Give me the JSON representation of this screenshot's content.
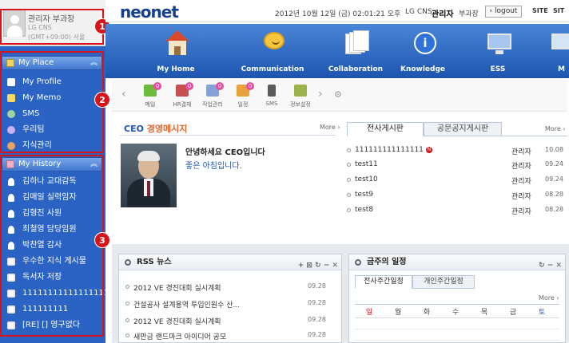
{
  "profile": {
    "name": "관리자 부과장",
    "company": "LG CNS",
    "timezone": "(GMT+09:00) 서울"
  },
  "sidebar": {
    "my_place": {
      "title": "My Place",
      "items": [
        {
          "label": "My Profile",
          "icon": "profile-icon"
        },
        {
          "label": "My Memo",
          "icon": "memo-icon"
        },
        {
          "label": "SMS",
          "icon": "sms-icon"
        },
        {
          "label": "우리팀",
          "icon": "team-icon"
        },
        {
          "label": "지식관리",
          "icon": "knowledge-icon"
        }
      ]
    },
    "my_history": {
      "title": "My History",
      "items": [
        {
          "label": "김하나 교대감독",
          "icon": "person-icon"
        },
        {
          "label": "김매일 실력임자",
          "icon": "person-icon"
        },
        {
          "label": "김형진 사원",
          "icon": "person-icon"
        },
        {
          "label": "최철영 담당임원",
          "icon": "person-icon"
        },
        {
          "label": "박찬열 감사",
          "icon": "person-icon"
        },
        {
          "label": "우수한 지식 게시물",
          "icon": "page-icon"
        },
        {
          "label": "독서자 저장",
          "icon": "page-icon"
        },
        {
          "label": "11111111111111111",
          "icon": "page-icon"
        },
        {
          "label": "111111111",
          "icon": "page-icon"
        },
        {
          "label": "[RE] [] 영구없다",
          "icon": "page-icon"
        }
      ]
    }
  },
  "callouts": [
    "1",
    "2",
    "3"
  ],
  "header": {
    "logo": "neonet",
    "datetime": "2012년 10월 12일 (금) 02:01:21 오후",
    "company": "LG CNS",
    "admin": "관리자",
    "title": "부과장",
    "logout": "logout",
    "site_links": [
      "SITE",
      "SIT"
    ]
  },
  "mainnav": [
    {
      "label": "My Home",
      "icon": "home-icon"
    },
    {
      "label": "Communication",
      "icon": "chat-bubble-icon"
    },
    {
      "label": "Collaboration",
      "icon": "documents-icon"
    },
    {
      "label": "Knowledge",
      "icon": "info-icon"
    },
    {
      "label": "ESS",
      "icon": "computer-icon"
    },
    {
      "label": "M",
      "icon": "more-menu-icon"
    }
  ],
  "quickbar": [
    {
      "label": "메일",
      "badge": "0",
      "icon": "mail-icon",
      "color": "#6dbb3a"
    },
    {
      "label": "HR결재",
      "badge": "0",
      "icon": "approval-icon",
      "color": "#c74f4f"
    },
    {
      "label": "작업관리",
      "badge": "0",
      "icon": "task-icon",
      "color": "#84a2d8"
    },
    {
      "label": "일정",
      "badge": "0",
      "icon": "calendar-icon",
      "color": "#e8a23c"
    },
    {
      "label": "SMS",
      "badge": "",
      "icon": "phone-icon",
      "color": "#5a5a5a"
    },
    {
      "label": "정보설정",
      "badge": "",
      "icon": "settings-icon",
      "color": "#9bb44a"
    }
  ],
  "ceo": {
    "title_prefix": "CEO ",
    "title_main": "경영메시지",
    "more": "More",
    "greeting": "안녕하세요 CEO입니다",
    "message": "좋은 아침입니다."
  },
  "board": {
    "tabs": [
      "전사게시판",
      "공문공지게시판"
    ],
    "more": "More",
    "rows": [
      {
        "title": "111111111111111",
        "new": "N",
        "author": "관리자",
        "date": "10.08"
      },
      {
        "title": "test11",
        "new": "",
        "author": "관리자",
        "date": "09.24"
      },
      {
        "title": "test10",
        "new": "",
        "author": "관리자",
        "date": "09.24"
      },
      {
        "title": "test9",
        "new": "",
        "author": "관리자",
        "date": "08.28"
      },
      {
        "title": "test8",
        "new": "",
        "author": "관리자",
        "date": "08.28"
      }
    ]
  },
  "rss": {
    "title": "RSS 뉴스",
    "controls": "+ ⊠ ↻ − ✕",
    "rows": [
      {
        "title": "2012 VE 경진대회 실시계획",
        "date": "09.28"
      },
      {
        "title": "건설공사 설계용역 투입인원수 산...",
        "date": "09.28"
      },
      {
        "title": "2012 VE 경진대회 실시계획",
        "date": "09.28"
      },
      {
        "title": "새만금 랜드마크 아이디어 공모",
        "date": "09.28"
      }
    ]
  },
  "schedule": {
    "title": "금주의 일정",
    "controls": "↻ − ✕",
    "tabs": [
      "전사주간일정",
      "개인주간일정"
    ],
    "more": "More",
    "days": [
      "일",
      "월",
      "화",
      "수",
      "목",
      "금",
      "토"
    ]
  },
  "colors": {
    "sidebar": "#2b63c4",
    "nav": "#1d55b0",
    "callout": "#d8141b",
    "accent": "#e7632b"
  }
}
